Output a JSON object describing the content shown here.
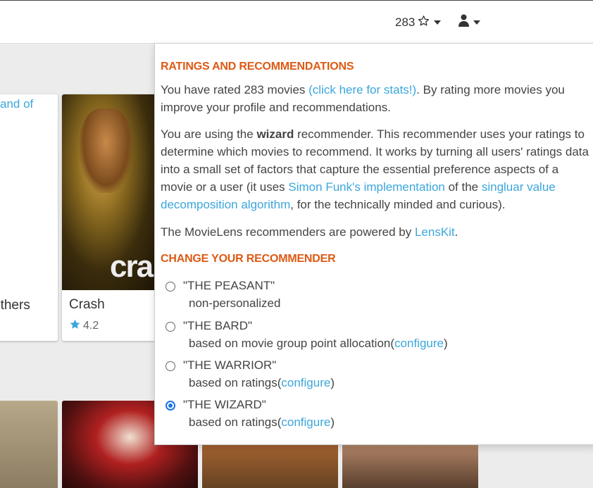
{
  "nav": {
    "rating_count": "283"
  },
  "cards": {
    "left_link_text": "and of",
    "left_title": "others",
    "crash_title": "Crash",
    "crash_rating": "4.2",
    "crash_poster_word": "cra"
  },
  "panel": {
    "heading_ratings": "RATINGS AND RECOMMENDATIONS",
    "p1_a": "You have rated 283 movies ",
    "p1_link": "(click here for stats!)",
    "p1_b": ". By rating more movies you improve your profile and recommendations.",
    "p2_a": "You are using the ",
    "p2_bold": "wizard",
    "p2_b": " recommender. This recommender uses your ratings to determine which movies to recommend. It works by turning all users' ratings data into a small set of factors that capture the essential preference aspects of a movie or a user (it uses ",
    "p2_link1": "Simon Funk's implementation",
    "p2_c": " of the ",
    "p2_link2": "singluar value decomposition algorithm",
    "p2_d": ", for the technically minded and curious).",
    "p3_a": "The MovieLens recommenders are powered by ",
    "p3_link": "LensKit",
    "p3_b": ".",
    "heading_change": "CHANGE YOUR RECOMMENDER",
    "options": [
      {
        "name": "\"THE PEASANT\"",
        "desc": "non-personalized",
        "configure": "",
        "desc_end": "",
        "checked": false
      },
      {
        "name": "\"THE BARD\"",
        "desc": "based on movie group point allocation(",
        "configure": "configure",
        "desc_end": ")",
        "checked": false
      },
      {
        "name": "\"THE WARRIOR\"",
        "desc": "based on ratings(",
        "configure": "configure",
        "desc_end": ")",
        "checked": false
      },
      {
        "name": "\"THE WIZARD\"",
        "desc": "based on ratings(",
        "configure": "configure",
        "desc_end": ")",
        "checked": true
      }
    ]
  },
  "colors": {
    "accent_orange": "#dd5a14",
    "link_blue": "#3ba6dc",
    "radio_blue": "#1a73e8"
  },
  "icons": [
    "star-outline-icon",
    "caret-down-icon",
    "user-icon",
    "star-filled-icon"
  ]
}
